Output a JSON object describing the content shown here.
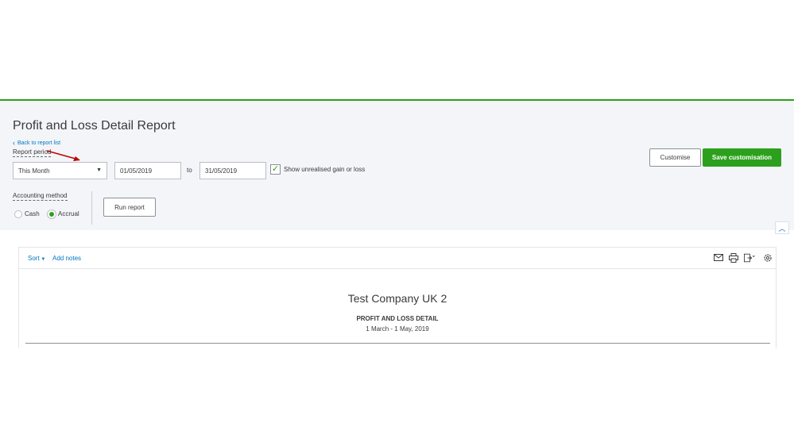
{
  "page": {
    "title": "Profit and Loss Detail Report",
    "back_link": "Back to report list"
  },
  "filters": {
    "period_label": "Report period",
    "period_value": "This Month",
    "date_from": "01/05/2019",
    "to_label": "to",
    "date_to": "31/05/2019",
    "unrealised_label": "Show unrealised gain or loss",
    "unrealised_checked": true,
    "method_label": "Accounting method",
    "method_options": [
      "Cash",
      "Accrual"
    ],
    "method_selected": "Accrual",
    "run_report_label": "Run report"
  },
  "actions": {
    "customise_label": "Customise",
    "save_label": "Save customisation"
  },
  "report": {
    "toolbar": {
      "sort_label": "Sort",
      "add_notes_label": "Add notes",
      "icons": [
        "mail-icon",
        "print-icon",
        "export-icon",
        "gear-icon"
      ]
    },
    "company_name": "Test Company UK 2",
    "report_name": "PROFIT AND LOSS DETAIL",
    "date_range": "1 March - 1 May, 2019"
  },
  "colors": {
    "accent_green": "#2ca01c",
    "link_blue": "#0077c5",
    "annotation_arrow": "#c00000",
    "panel_bg": "#f4f5f8"
  }
}
